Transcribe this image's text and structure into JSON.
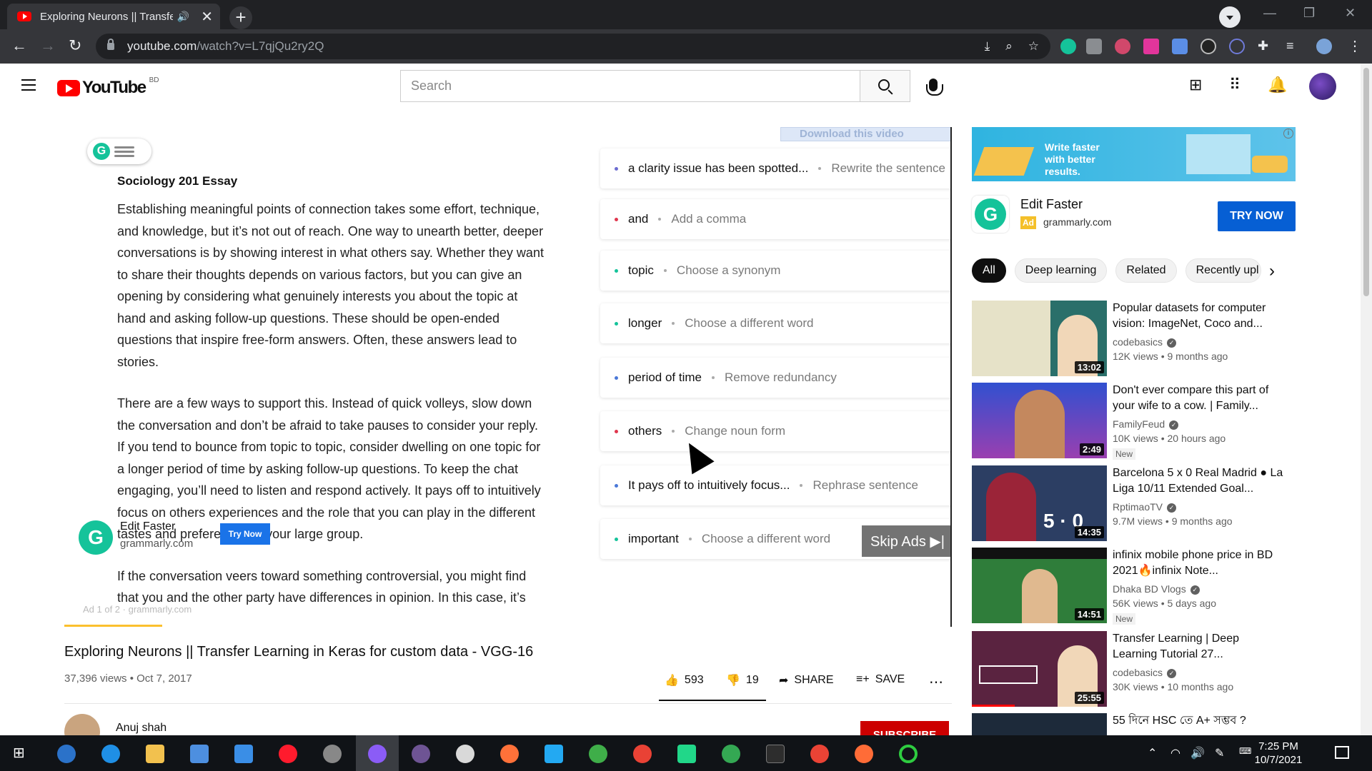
{
  "browser": {
    "tab_title": "Exploring Neurons || Transfer",
    "tab_audio_icon": "speaker-icon",
    "tab_close": "✕",
    "new_tab": "+",
    "url_host": "youtube.com",
    "url_path": "/watch?v=L7qjQu2ry2Q"
  },
  "header": {
    "logo_text": "YouTube",
    "country_code": "BD",
    "search_placeholder": "Search"
  },
  "player": {
    "download_banner": "Download this video",
    "essay_title": "Sociology 201 Essay",
    "paragraphs": [
      "Establishing meaningful points of connection takes some effort, technique, and knowledge, but it’s not out of reach. One way to unearth better, deeper conversations is by showing interest in what others say. Whether they want to share their thoughts depends on various factors, but you can give an opening by considering what genuinely interests you about the topic at hand and asking follow-up questions. These should be open-ended questions that inspire free-form answers. Often, these answers lead to stories.",
      "There are a few ways to support this. Instead of quick volleys, slow down the conversation and don’t be afraid to take pauses to consider your reply. If you tend to bounce from topic to topic, consider dwelling on one topic for a longer period of time by asking follow-up questions. To keep the chat engaging, you’ll need to listen and respond actively. It pays off to intuitively focus on others experiences and the role that you can play in the different tastes and preferences of your large group.",
      "If the conversation veers toward something controversial, you might find that you and the other party have differences in opinion. In this case, it’s"
    ],
    "suggestions": [
      {
        "word": "a clarity issue has been spotted...",
        "action": "Rewrite the sentence",
        "color": "#6c6cd1"
      },
      {
        "word": "and",
        "action": "Add a comma",
        "color": "#e0364e"
      },
      {
        "word": "topic",
        "action": "Choose a synonym",
        "color": "#15c39a"
      },
      {
        "word": "longer",
        "action": "Choose a different word",
        "color": "#15c39a"
      },
      {
        "word": "period of time",
        "action": "Remove redundancy",
        "color": "#4a78d8"
      },
      {
        "word": "others",
        "action": "Change noun form",
        "color": "#e0364e"
      },
      {
        "word": "It pays off to intuitively focus...",
        "action": "Rephrase sentence",
        "color": "#4a78d8"
      },
      {
        "word": "important",
        "action": "Choose a different word",
        "color": "#15c39a"
      }
    ],
    "overlay_ad": {
      "title": "Edit Faster",
      "domain": "grammarly.com",
      "button": "Try Now"
    },
    "skip_label": "Skip Ads ▶|",
    "ad_caption": "Ad 1 of 2 · grammarly.com",
    "progress_fraction": 0.11
  },
  "video": {
    "title": "Exploring Neurons || Transfer Learning in Keras for custom data - VGG-16",
    "meta": "37,396 views • Oct 7, 2017",
    "likes": "593",
    "dislikes": "19",
    "share": "SHARE",
    "save": "SAVE",
    "channel": "Anuj shah",
    "subscribe": "SUBSCRIBE"
  },
  "sidebar_ad": {
    "banner_text": "Write faster with better results.",
    "title": "Edit Faster",
    "badge": "Ad",
    "domain": "grammarly.com",
    "button": "TRY NOW"
  },
  "chips": [
    "All",
    "Deep learning",
    "Related",
    "Recently upl"
  ],
  "recommendations": [
    {
      "title": "Popular datasets for computer vision: ImageNet, Coco and...",
      "channel": "codebasics",
      "meta": "12K views • 9 months ago",
      "duration": "13:02",
      "new": "",
      "thumb": "#2a6f6a"
    },
    {
      "title": "Don't ever compare this part of your wife to a cow. | Family...",
      "channel": "FamilyFeud",
      "meta": "10K views • 20 hours ago",
      "duration": "2:49",
      "new": "New",
      "thumb": "#3c55c9"
    },
    {
      "title": "Barcelona 5 x 0 Real Madrid ● La Liga 10/11 Extended Goal...",
      "channel": "RptimaoTV",
      "meta": "9.7M views • 9 months ago",
      "duration": "14:35",
      "new": "",
      "thumb": "#5a1f28"
    },
    {
      "title": "infinix mobile phone price in BD 2021🔥infinix Note...",
      "channel": "Dhaka BD Vlogs",
      "meta": "56K views • 5 days ago",
      "duration": "14:51",
      "new": "New",
      "thumb": "#2f7d3a"
    },
    {
      "title": "Transfer Learning | Deep Learning Tutorial 27...",
      "channel": "codebasics",
      "meta": "30K views • 10 months ago",
      "duration": "25:55",
      "new": "",
      "thumb": "#5a2340"
    },
    {
      "title": "55 দিনে HSC তে A+ সম্ভব ?",
      "channel": "",
      "meta": "",
      "duration": "",
      "new": "",
      "thumb": "#1d2a3a"
    }
  ],
  "taskbar": {
    "time": "7:25 PM",
    "date": "10/7/2021"
  }
}
